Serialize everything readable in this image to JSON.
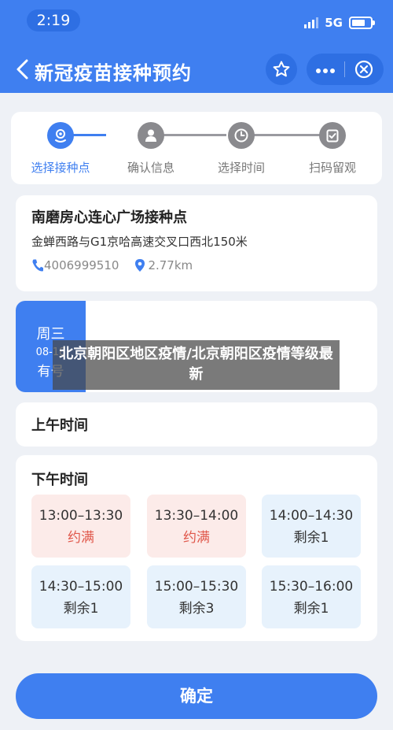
{
  "status_bar": {
    "time": "2:19",
    "network": "5G"
  },
  "header": {
    "title": "新冠疫苗接种预约",
    "more_icon": "more-dots-icon",
    "close_icon": "close-circle-icon"
  },
  "steps": [
    {
      "label": "选择接种点",
      "icon": "location-pin-icon",
      "active": true
    },
    {
      "label": "确认信息",
      "icon": "user-icon",
      "active": false
    },
    {
      "label": "选择时间",
      "icon": "clock-icon",
      "active": false
    },
    {
      "label": "扫码留观",
      "icon": "scan-check-icon",
      "active": false
    }
  ],
  "site": {
    "name": "南磨房心连心广场接种点",
    "address": "金蝉西路与G1京哈高速交叉口西北150米",
    "phone": "4006999510",
    "distance": "2.77km"
  },
  "date": {
    "weekday": "周三",
    "date": "08-18",
    "status": "有号"
  },
  "overlay_text": "北京朝阳区地区疫情/北京朝阳区疫情等级最新",
  "morning": {
    "title": "上午时间"
  },
  "afternoon": {
    "title": "下午时间",
    "slots": [
      {
        "time": "13:00–13:30",
        "status": "约满"
      },
      {
        "time": "13:30–14:00",
        "status": "约满"
      },
      {
        "time": "14:00–14:30",
        "status": "剩余1"
      },
      {
        "time": "14:30–15:00",
        "status": "剩余1"
      },
      {
        "time": "15:00–15:30",
        "status": "剩余3"
      },
      {
        "time": "15:30–16:00",
        "status": "剩余1"
      }
    ]
  },
  "confirm_label": "确定",
  "colors": {
    "primary": "#3f7ff0",
    "full_bg": "#fcebe9",
    "full_text": "#e0584b",
    "avail_bg": "#e7f2fc"
  }
}
